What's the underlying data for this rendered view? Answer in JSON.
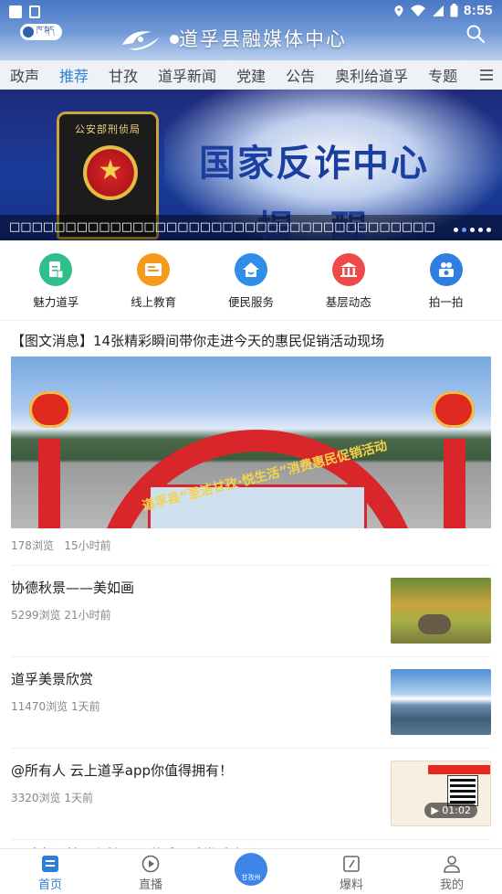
{
  "status_bar": {
    "time": "8:55"
  },
  "header": {
    "title": "道孚县融媒体中心",
    "lang_toggle_label": "ཁ་སྐད",
    "search_icon": "search-icon"
  },
  "tabs": [
    {
      "label": "政声",
      "active": false
    },
    {
      "label": "推荐",
      "active": true
    },
    {
      "label": "甘孜",
      "active": false
    },
    {
      "label": "道孚新闻",
      "active": false
    },
    {
      "label": "党建",
      "active": false
    },
    {
      "label": "公告",
      "active": false
    },
    {
      "label": "奥利给道孚",
      "active": false
    },
    {
      "label": "专题",
      "active": false
    }
  ],
  "banner": {
    "badge_text": "公安部刑侦局",
    "headline": "国家反诈中心",
    "sub": "提醒",
    "caption": "□□□□□□□□□□□□□□□□□□□□□□□□□□□□□□□□□□□□□□",
    "slide_count": 5,
    "active_slide": 1
  },
  "quick_nav": [
    {
      "label": "魅力道孚",
      "icon": "document-icon",
      "color": "#2fbf8a"
    },
    {
      "label": "线上教育",
      "icon": "book-icon",
      "color": "#f59a1c"
    },
    {
      "label": "便民服务",
      "icon": "home-icon",
      "color": "#2f8fe8"
    },
    {
      "label": "基层动态",
      "icon": "building-icon",
      "color": "#ef4a4a"
    },
    {
      "label": "拍一拍",
      "icon": "camera-people-icon",
      "color": "#2f7fe0"
    }
  ],
  "feed": {
    "featured": {
      "title": "【图文消息】14张精彩瞬间带你走进今天的惠民促销活动现场",
      "image_text": "道孚县“圣洁甘孜·悦生活”消费惠民促销活动",
      "views": "178浏览",
      "time": "15小时前"
    },
    "items": [
      {
        "title": "协德秋景——美如画",
        "views": "5299浏览",
        "time": "21小时前"
      },
      {
        "title": "道孚美景欣赏",
        "views": "11470浏览",
        "time": "1天前"
      },
      {
        "title": "@所有人  云上道孚app你值得拥有！",
        "views": "3320浏览",
        "time": "1天前",
        "duration": "01:02"
      }
    ],
    "partial_title": "县委书记林勇主持召开道孚县委常委会议"
  },
  "bottom_nav": [
    {
      "label": "首页",
      "active": true
    },
    {
      "label": "直播",
      "active": false
    },
    {
      "label": "甘孜州",
      "active": false
    },
    {
      "label": "爆料",
      "active": false
    },
    {
      "label": "我的",
      "active": false
    }
  ],
  "colors": {
    "accent": "#2f7fd9",
    "header_blue": "#4a78c4"
  }
}
